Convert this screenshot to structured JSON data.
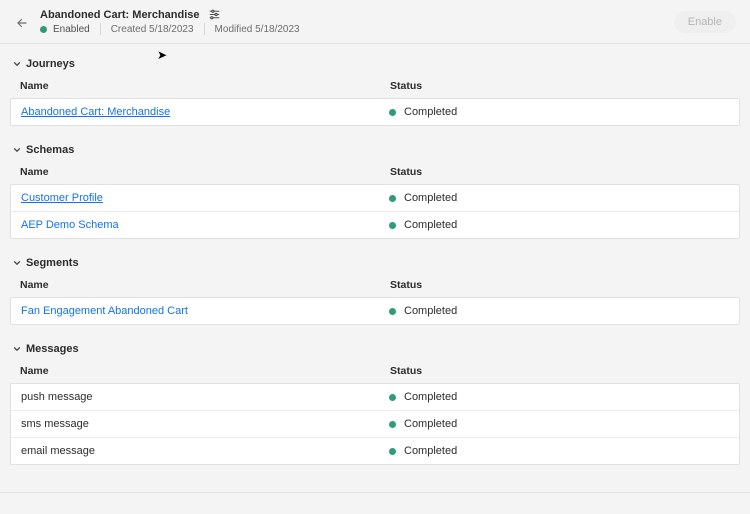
{
  "header": {
    "title": "Abandoned Cart: Merchandise",
    "status_label": "Enabled",
    "created_label": "Created 5/18/2023",
    "modified_label": "Modified 5/18/2023",
    "enable_button": "Enable"
  },
  "columns": {
    "name": "Name",
    "status": "Status"
  },
  "sections": {
    "journeys": {
      "title": "Journeys",
      "rows": [
        {
          "name": "Abandoned Cart: Merchandise",
          "status": "Completed",
          "link": true,
          "underline": true
        }
      ]
    },
    "schemas": {
      "title": "Schemas",
      "rows": [
        {
          "name": "Customer Profile",
          "status": "Completed",
          "link": true,
          "underline": true
        },
        {
          "name": "AEP Demo Schema",
          "status": "Completed",
          "link": true,
          "underline": false
        }
      ]
    },
    "segments": {
      "title": "Segments",
      "rows": [
        {
          "name": "Fan Engagement Abandoned Cart",
          "status": "Completed",
          "link": true,
          "underline": false
        }
      ]
    },
    "messages": {
      "title": "Messages",
      "rows": [
        {
          "name": "push message",
          "status": "Completed",
          "link": false
        },
        {
          "name": "sms message",
          "status": "Completed",
          "link": false
        },
        {
          "name": "email message",
          "status": "Completed",
          "link": false
        }
      ]
    }
  }
}
